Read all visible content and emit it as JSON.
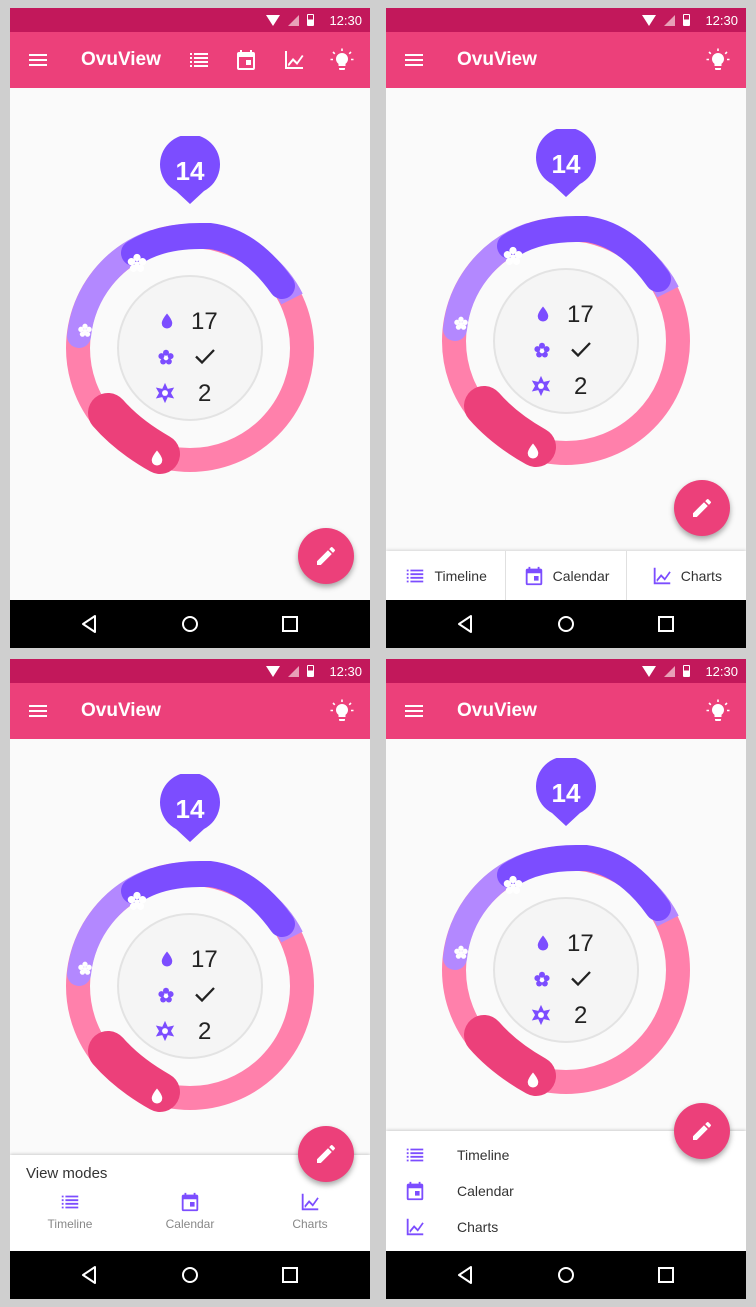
{
  "status": {
    "time": "12:30"
  },
  "app": {
    "title": "OvuView"
  },
  "dial": {
    "day_bubble": "14",
    "days_of_period": "17",
    "fertile_status": "✓",
    "ovulation_days": "2"
  },
  "bottom_tabs": [
    "Timeline",
    "Calendar",
    "Charts"
  ],
  "view_modes_sheet": {
    "heading": "View modes",
    "tabs": [
      "Timeline",
      "Calendar",
      "Charts"
    ]
  },
  "list_sheet": {
    "items": [
      "Timeline",
      "Calendar",
      "Charts"
    ]
  },
  "colors": {
    "status_bar": "#c2185b",
    "toolbar": "#ec407a",
    "accent_purple": "#7c4dff",
    "ring_pink": "#ff80ab",
    "fab": "#ec407a"
  },
  "icons": {
    "toolbar": [
      "menu-icon",
      "list-icon",
      "calendar-icon",
      "chart-icon",
      "lightbulb-icon"
    ],
    "dial": [
      "drop-icon",
      "flower-icon",
      "check-icon",
      "star-flower-icon"
    ],
    "fab": "pencil-icon"
  }
}
